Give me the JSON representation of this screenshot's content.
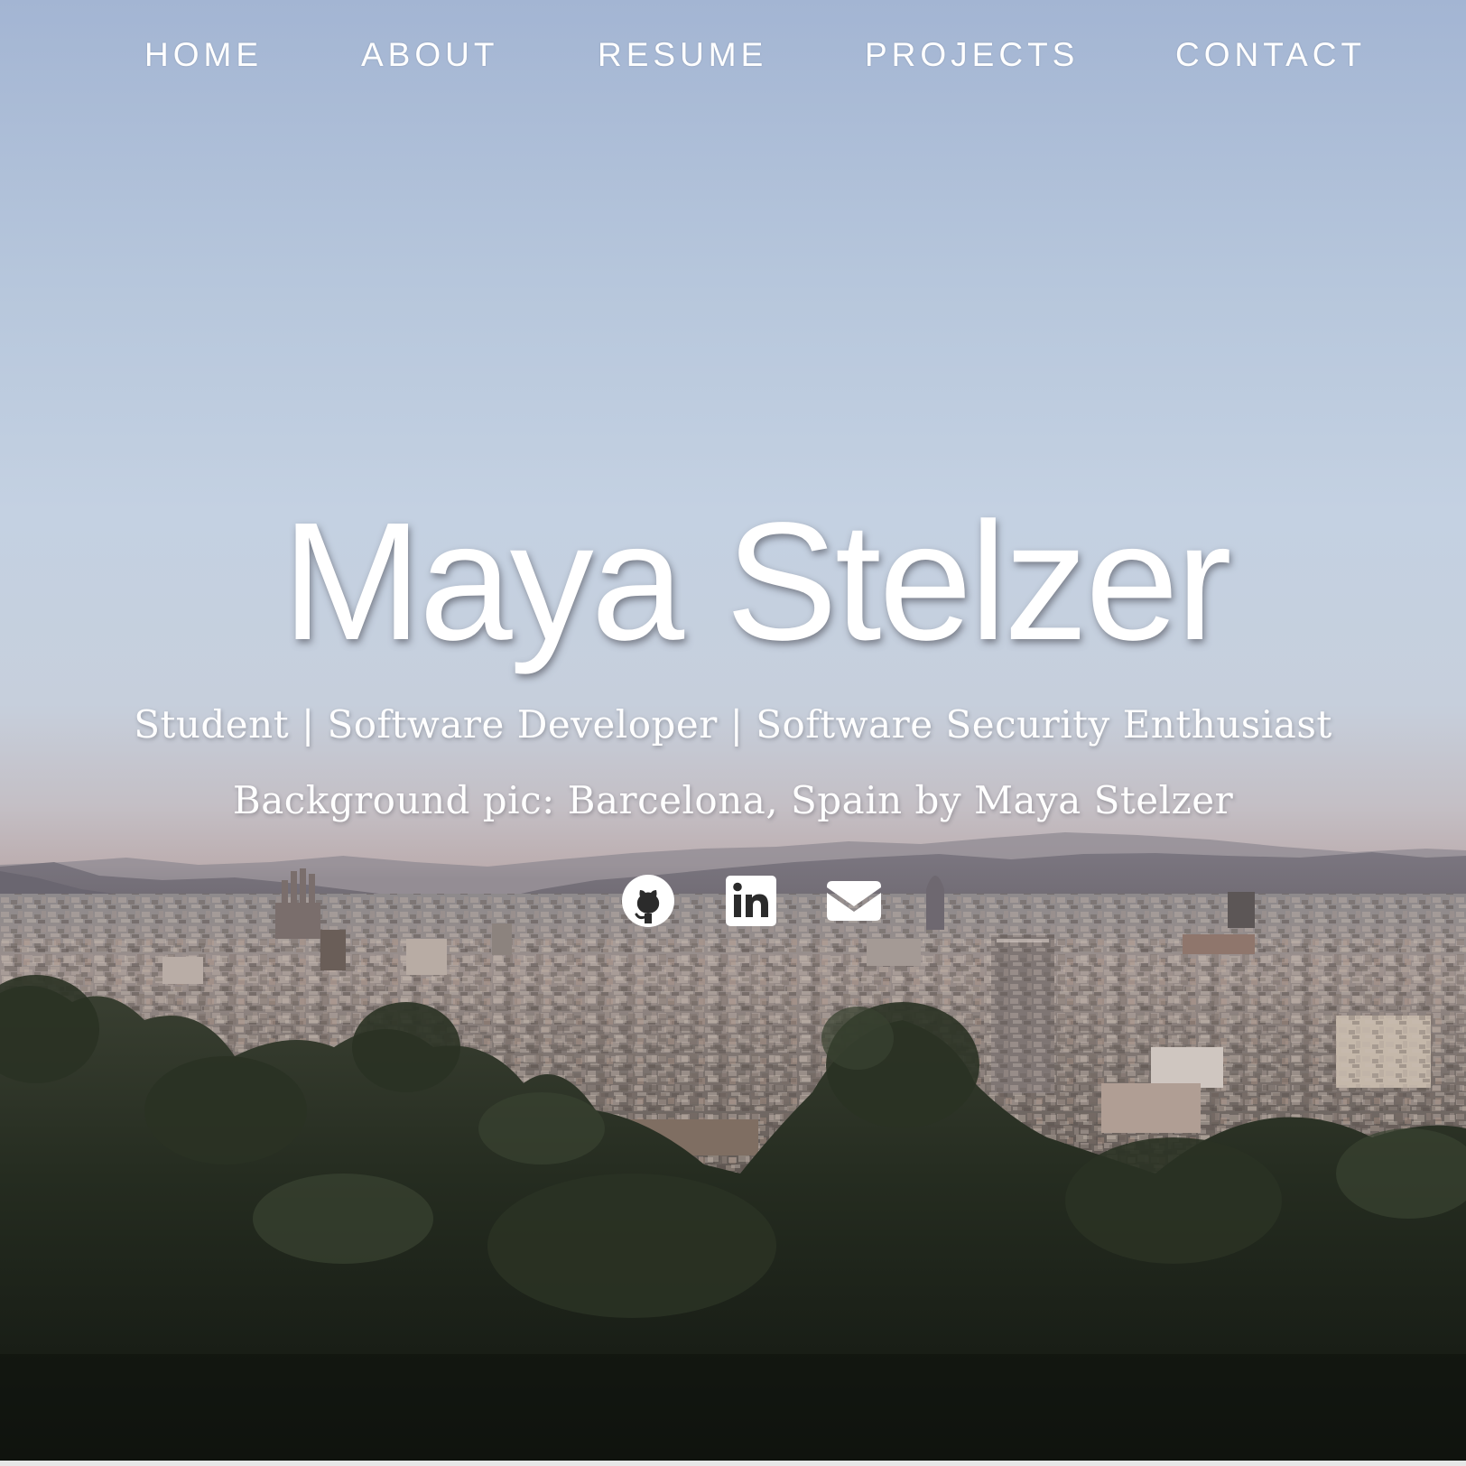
{
  "nav": {
    "items": [
      {
        "label": "HOME"
      },
      {
        "label": "ABOUT"
      },
      {
        "label": "RESUME"
      },
      {
        "label": "PROJECTS"
      },
      {
        "label": "CONTACT"
      }
    ]
  },
  "hero": {
    "name": "Maya Stelzer",
    "tagline": "Student | Software Developer | Software Security Enthusiast",
    "credit": "Background pic: Barcelona, Spain by Maya Stelzer",
    "background": "Barcelona cityscape at dusk"
  },
  "social": {
    "links": [
      {
        "icon": "github-icon"
      },
      {
        "icon": "linkedin-icon"
      },
      {
        "icon": "email-icon"
      }
    ]
  },
  "colors": {
    "text": "#ffffff",
    "sky_top": "#a3b5d3",
    "horizon": "#bcaeb0",
    "foliage": "#1c2418"
  }
}
